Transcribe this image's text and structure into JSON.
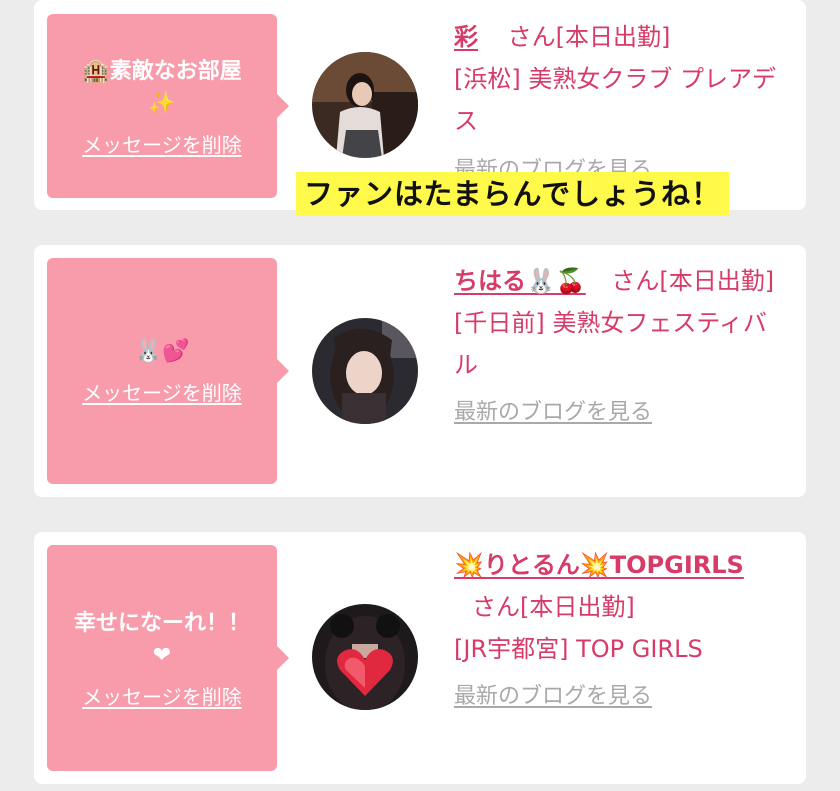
{
  "cards": [
    {
      "message": "🏨素敵なお部屋",
      "message_emoji": "✨",
      "delete_label": "メッセージを削除",
      "name": "彩",
      "suffix": "さん[本日出勤]",
      "shop": "[浜松] 美熟女クラブ プレアデス",
      "blog_label": "最新のブログを見る"
    },
    {
      "message": "",
      "message_emoji": "🐰💕",
      "delete_label": "メッセージを削除",
      "name": "ちはる🐰🍒",
      "suffix": "さん[本日出勤]",
      "shop": "[千日前] 美熟女フェスティバル",
      "blog_label": "最新のブログを見る"
    },
    {
      "message": "幸せになーれ！！",
      "message_emoji": "❤",
      "delete_label": "メッセージを削除",
      "name": "💥りとるん💥TOPGIRLS",
      "suffix": "さん[本日出勤]",
      "shop": "[JR宇都宮] TOP GIRLS",
      "blog_label": "最新のブログを見る"
    }
  ],
  "caption": "ファンはたまらんでしょうね！",
  "colors": {
    "accent": "#d73b68",
    "message_bg": "#f89cac",
    "caption_bg": "#fff94a",
    "blog_link": "#a9a9a9"
  }
}
